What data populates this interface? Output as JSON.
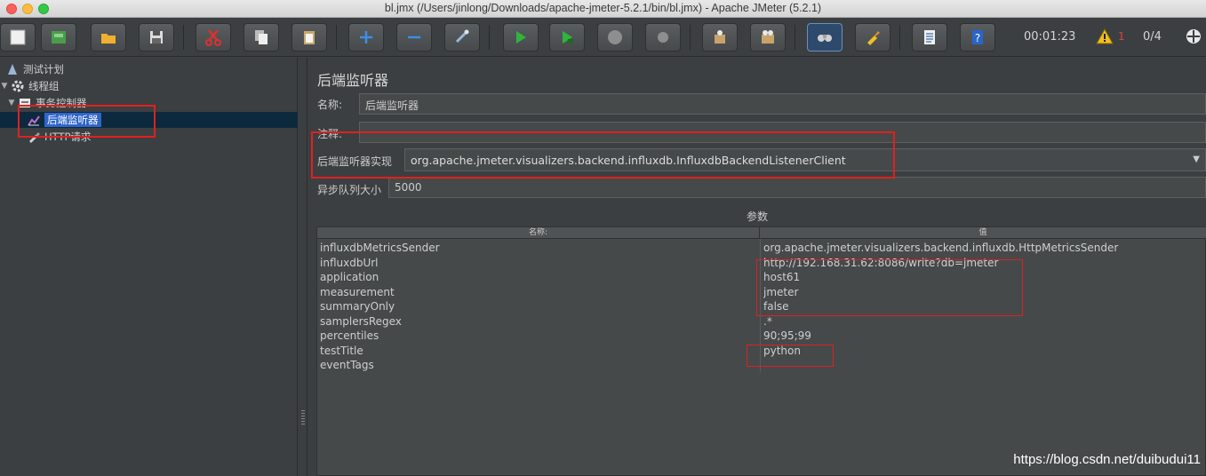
{
  "window": {
    "title": "bl.jmx (/Users/jinlong/Downloads/apache-jmeter-5.2.1/bin/bl.jmx) - Apache JMeter (5.2.1)"
  },
  "toolbar": {
    "buttons": [
      {
        "name": "new-icon"
      },
      {
        "name": "templates-icon"
      },
      {
        "name": "open-icon"
      },
      {
        "name": "save-icon"
      },
      {
        "name": "cut-icon"
      },
      {
        "name": "copy-icon"
      },
      {
        "name": "paste-icon"
      },
      {
        "name": "expand-icon"
      },
      {
        "name": "collapse-icon"
      },
      {
        "name": "toggle-icon"
      },
      {
        "name": "start-icon"
      },
      {
        "name": "start-no-pause-icon"
      },
      {
        "name": "stop-icon"
      },
      {
        "name": "shutdown-icon"
      },
      {
        "name": "clear-icon"
      },
      {
        "name": "clear-all-icon"
      },
      {
        "name": "search-icon"
      },
      {
        "name": "reset-search-icon"
      },
      {
        "name": "function-helper-icon"
      },
      {
        "name": "help-icon"
      }
    ],
    "timer": "00:01:23",
    "warning_count": "1",
    "threads": "0/4",
    "accent_active": "#2d4a6c"
  },
  "tree": {
    "items": [
      {
        "label": "测试计划",
        "icon": "test-plan-icon",
        "level": 0
      },
      {
        "label": "线程组",
        "icon": "gear-icon",
        "level": 0
      },
      {
        "label": "事务控制器",
        "icon": "controller-icon",
        "level": 1
      },
      {
        "label": "后端监听器",
        "icon": "chart-icon",
        "level": 2,
        "selected": true
      },
      {
        "label": "HTTP请求",
        "icon": "pipette-icon",
        "level": 2
      }
    ]
  },
  "panel": {
    "title": "后端监听器",
    "name_label": "名称:",
    "name_value": "后端监听器",
    "comment_label": "注释:",
    "comment_value": "",
    "impl_label": "后端监听器实现",
    "impl_value": "org.apache.jmeter.visualizers.backend.influxdb.InfluxdbBackendListenerClient",
    "queue_label": "异步队列大小",
    "queue_value": "5000",
    "params_title": "参数",
    "table": {
      "col_name": "名称:",
      "col_value": "值",
      "rows": [
        {
          "name": "influxdbMetricsSender",
          "value": "org.apache.jmeter.visualizers.backend.influxdb.HttpMetricsSender"
        },
        {
          "name": "influxdbUrl",
          "value": "http://192.168.31.62:8086/write?db=jmeter"
        },
        {
          "name": "application",
          "value": "host61"
        },
        {
          "name": "measurement",
          "value": "jmeter"
        },
        {
          "name": "summaryOnly",
          "value": "false"
        },
        {
          "name": "samplersRegex",
          "value": ".*"
        },
        {
          "name": "percentiles",
          "value": "90;95;99"
        },
        {
          "name": "testTitle",
          "value": "python"
        },
        {
          "name": "eventTags",
          "value": ""
        }
      ]
    }
  },
  "watermark": "https://blog.csdn.net/duibudui11",
  "colors": {
    "background": "#3c3f41",
    "selection": "#2f65ca",
    "highlight_box": "#e02020"
  }
}
